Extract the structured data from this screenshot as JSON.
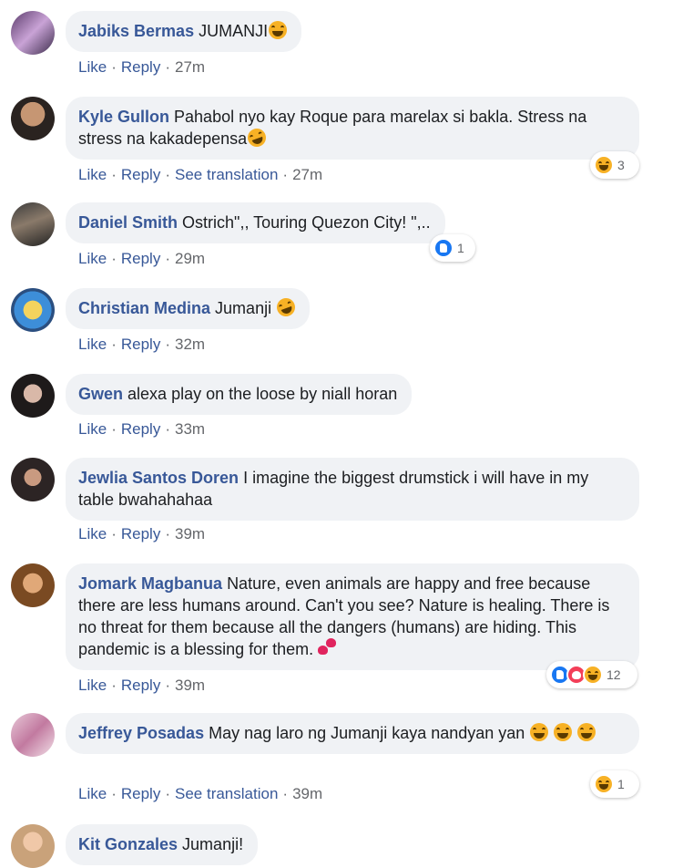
{
  "action_labels": {
    "like": "Like",
    "reply": "Reply",
    "see_translation": "See translation",
    "separator": "·"
  },
  "colors": {
    "author": "#385898",
    "bubble": "#f0f2f5",
    "meta": "#65676b",
    "like": "#1877f2",
    "haha": "#f7b125",
    "love": "#f33e58"
  },
  "comments": [
    {
      "author": "Jabiks Bermas",
      "text": "JUMANJI",
      "time": "27m",
      "emoji": "haha",
      "translation": false
    },
    {
      "author": "Kyle Gullon",
      "text": "Pahabol nyo kay Roque para marelax si bakla. Stress na stress na kakadepensa",
      "time": "27m",
      "emoji": "rofl",
      "translation": true,
      "reactions": {
        "icons": [
          "haha"
        ],
        "count": "3"
      }
    },
    {
      "author": "Daniel Smith",
      "text": "Ostrich\",, Touring Quezon City! \",..",
      "time": "29m",
      "translation": false,
      "reactions": {
        "icons": [
          "like"
        ],
        "count": "1"
      }
    },
    {
      "author": "Christian Medina",
      "text": "Jumanji",
      "time": "32m",
      "emoji": "rofl",
      "translation": false
    },
    {
      "author": "Gwen",
      "text": "alexa play on the loose by niall horan",
      "time": "33m",
      "translation": false
    },
    {
      "author": "Jewlia Santos Doren",
      "text": "I imagine the biggest drumstick i will have in my table bwahahahaa",
      "time": "39m",
      "translation": false
    },
    {
      "author": "Jomark Magbanua",
      "text": "Nature, even animals are happy and free because there are less humans around. Can't you see? Nature is healing. There is no threat for them because all the dangers (humans) are hiding. This pandemic is a blessing for them.",
      "time": "39m",
      "emoji": "hearts",
      "translation": false,
      "reactions": {
        "icons": [
          "like",
          "love",
          "haha"
        ],
        "count": "12"
      }
    },
    {
      "author": "Jeffrey Posadas",
      "text": "May nag laro ng Jumanji kaya nandyan yan",
      "time": "39m",
      "emoji": "haha-triple",
      "translation": true,
      "reactions": {
        "icons": [
          "haha"
        ],
        "count": "1"
      }
    },
    {
      "author": "Kit Gonzales",
      "text": "Jumanji!",
      "time": "",
      "translation": false
    }
  ]
}
